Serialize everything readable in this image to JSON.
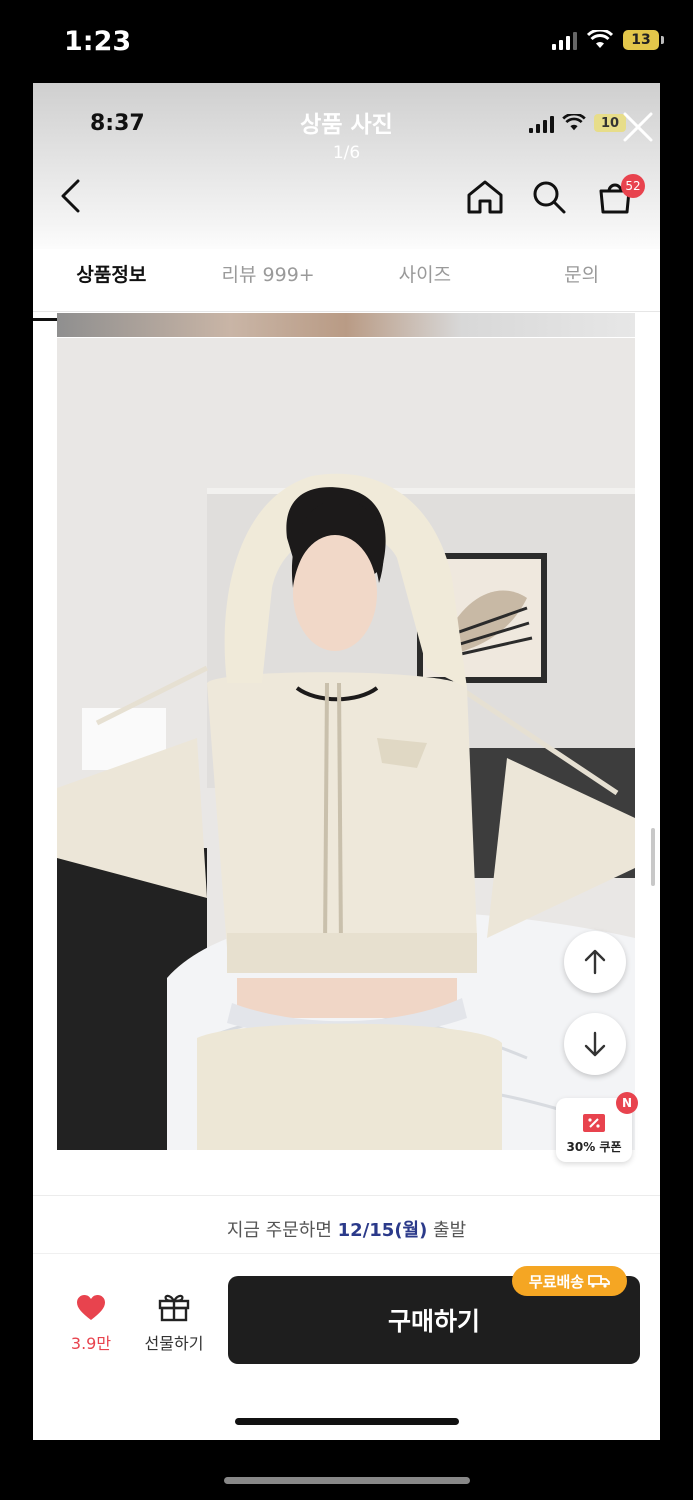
{
  "outer_status": {
    "time": "1:23",
    "battery": "13"
  },
  "inner_status": {
    "time": "8:37",
    "battery": "10"
  },
  "viewer": {
    "title": "상품 사진",
    "counter": "1/6"
  },
  "header": {
    "cart_count": "52"
  },
  "tabs": [
    {
      "label": "상품정보",
      "active": true
    },
    {
      "label": "리뷰 999+",
      "active": false
    },
    {
      "label": "사이즈",
      "active": false
    },
    {
      "label": "문의",
      "active": false
    }
  ],
  "coupon": {
    "badge": "N",
    "label": "30% 쿠폰"
  },
  "shipping": {
    "prefix": "지금 주문하면 ",
    "date": "12/15(월)",
    "suffix": " 출발"
  },
  "bottom_bar": {
    "like_count": "3.9만",
    "gift_label": "선물하기",
    "buy_label": "구매하기",
    "free_shipping_label": "무료배송"
  },
  "colors": {
    "accent_red": "#e8434e",
    "buy_button": "#1e1e1e",
    "free_shipping": "#f5a623"
  }
}
